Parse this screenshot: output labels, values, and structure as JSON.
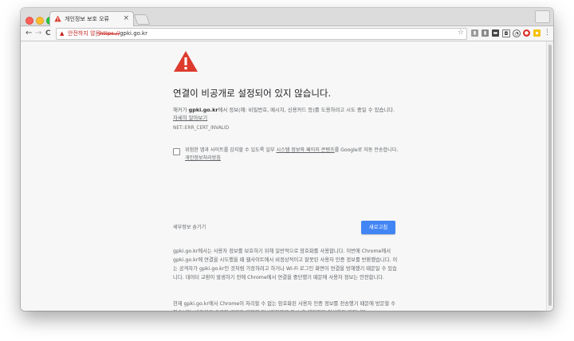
{
  "tab": {
    "title": "개인정보 보호 오류",
    "close": "×"
  },
  "toolbar": {
    "back": "←",
    "forward": "→",
    "reload": "C",
    "security_label": "안전하지 않음",
    "url_scheme": "https://",
    "url_host": "gpki.go.kr",
    "bookmark": "☆"
  },
  "interstitial": {
    "heading": "연결이 비공개로 설정되어 있지 않습니다.",
    "para_prefix": "해커가 ",
    "para_host": "gpki.go.kr",
    "para_text": "에서 정보(예: 비밀번호, 메시지, 신용카드 등)를 도용하려고 시도 중일 수 있습니다. ",
    "learn_more": "자세히 알아보기",
    "error_code": "NET::ERR_CERT_INVALID",
    "checkbox_before": "위험한 앱과 사이트를 감지할 수 있도록 일부 ",
    "checkbox_link": "시스템 정보와 페이지 콘텐츠",
    "checkbox_after": "를 Google로 자동 전송합니다. ",
    "checkbox_privacy": "개인정보처리방침",
    "advanced": "세부정보 숨기기",
    "reload_button": "새로고침",
    "details_1": "gpki.go.kr에서는 사용자 정보를 보호하기 위해 일반적으로 암호화를 사용합니다. 이번에 Chrome에서 gpki.go.kr에 연결을 시도했을 때 웹사이트에서 비정상적이고 잘못된 사용자 인증 정보를 반환했습니다. 이는 공격자가 gpki.go.kr인 것처럼 가장하려고 하거나 Wi-Fi 로그인 화면이 연결을 방해했기 때문일 수 있습니다. 데이터 교환이 발생하기 전에 Chrome에서 연결을 중단했기 때문에 사용자 정보는 안전합니다.",
    "details_2": "현재 gpki.go.kr에서 Chrome이 처리할 수 없는 암호화된 사용자 인증 정보를 전송했기 때문에 방문할 수 없습니다. 네트워크 오류와 공격은 대부분 일시적이므로 잠시 후 페이지가 정상화될 것입니다."
  },
  "colors": {
    "danger": "#dc3b2e",
    "accent": "#4285f4"
  }
}
